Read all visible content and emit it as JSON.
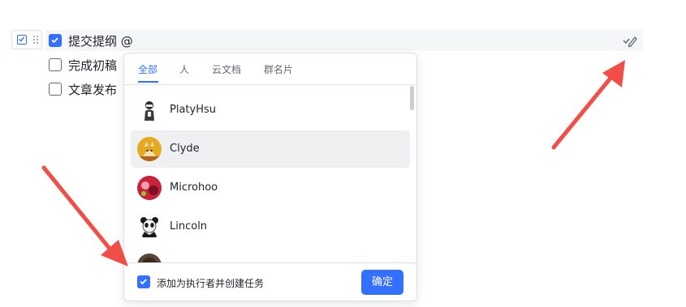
{
  "doc": {
    "tasks": [
      {
        "text": "提交提纲 @",
        "checked": true
      },
      {
        "text": "完成初稿",
        "checked": false
      },
      {
        "text": "文章发布",
        "checked": false
      }
    ]
  },
  "mention_popup": {
    "tabs": [
      {
        "label": "全部",
        "active": true
      },
      {
        "label": "人",
        "active": false
      },
      {
        "label": "云文档",
        "active": false
      },
      {
        "label": "群名片",
        "active": false
      }
    ],
    "items": [
      {
        "name": "PlatyHsu",
        "highlighted": false
      },
      {
        "name": "Clyde",
        "highlighted": true
      },
      {
        "name": "Microhoo",
        "highlighted": false
      },
      {
        "name": "Lincoln",
        "highlighted": false
      },
      {
        "name": "",
        "highlighted": false
      }
    ],
    "footer": {
      "checkbox_label": "添加为执行者并创建任务",
      "checkbox_checked": true,
      "confirm_label": "确定"
    }
  },
  "colors": {
    "accent": "#3370ff",
    "annotation_arrow": "#f04e46"
  }
}
